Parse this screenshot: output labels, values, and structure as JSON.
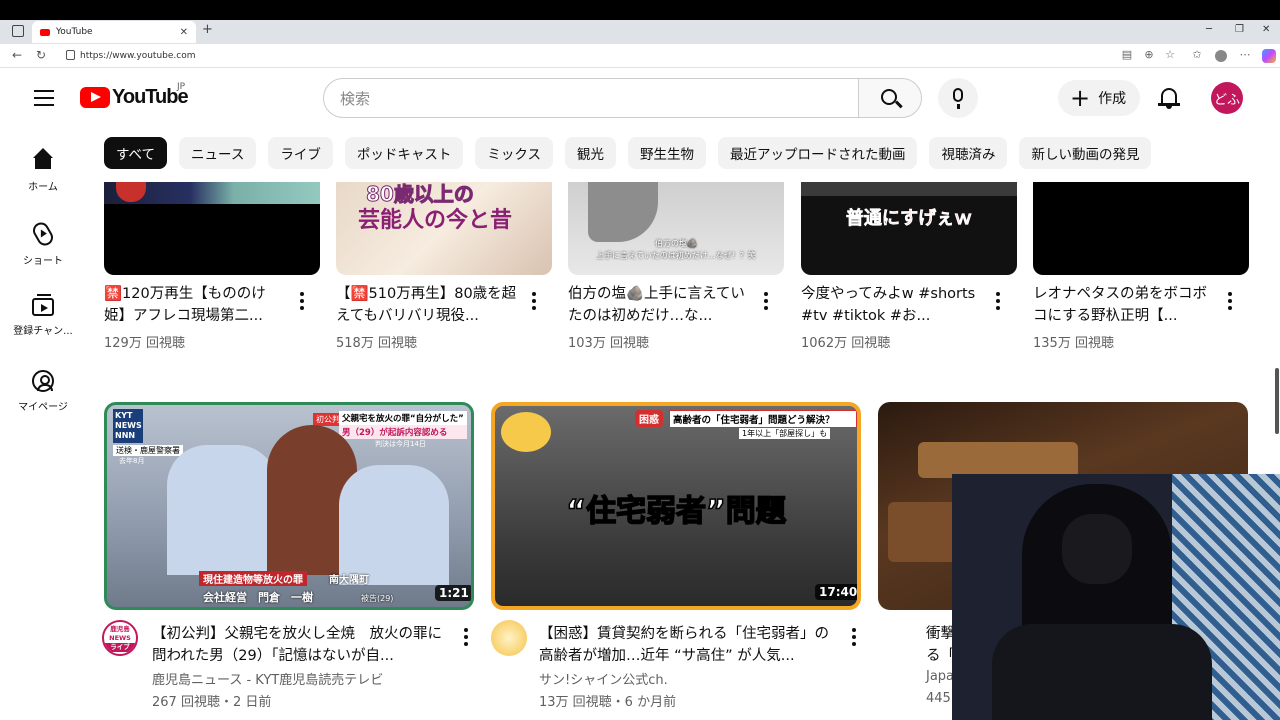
{
  "browser": {
    "tab_title": "YouTube",
    "tab_close": "✕",
    "new_tab": "+",
    "url": "https://www.youtube.com",
    "window_controls": [
      "─",
      "❐",
      "✕"
    ]
  },
  "header": {
    "logo_text": "YouTube",
    "region": "JP",
    "search_placeholder": "検索",
    "create_label": "作成",
    "avatar_text": "どふ"
  },
  "chips": [
    "すべて",
    "ニュース",
    "ライブ",
    "ポッドキャスト",
    "ミックス",
    "観光",
    "野生生物",
    "最近アップロードされた動画",
    "視聴済み",
    "新しい動画の発見"
  ],
  "sidebar": {
    "items": [
      {
        "label": "ホーム"
      },
      {
        "label": "ショート"
      },
      {
        "label": "登録チャン..."
      },
      {
        "label": "マイページ"
      }
    ]
  },
  "top_row": [
    {
      "title": "🈲120万再生【もののけ姫】アフレコ現場第二...",
      "views": "129万 回視聴"
    },
    {
      "title": "【🈲510万再生】80歳を超えてもバリバリ現役...",
      "views": "518万 回視聴",
      "thumb_text_1": "80歳以上の",
      "thumb_text_2": "芸能人の今と昔"
    },
    {
      "title": "伯方の塩🪨上手に言えていたのは初めだけ…な...",
      "views": "103万 回視聴",
      "thumb_caption": "伯方の塩🪨\n上手に言えていたのは初めだけ…なぜ！？笑"
    },
    {
      "title": "今度やってみよw #shorts #tv #tiktok #お...",
      "views": "1062万 回視聴",
      "thumb_text": "普通にすげぇｗ"
    },
    {
      "title": "レオナペタスの弟をボコボコにする野杁正明【...",
      "views": "135万 回視聴"
    }
  ],
  "bottom_row": [
    {
      "title": "【初公判】父親宅を放火し全焼　放火の罪に問われた男（29）「記憶はないが自...",
      "channel": "鹿児島ニュース - KYT鹿児島読売テレビ",
      "meta": "267 回視聴・2 日前",
      "duration": "1:21",
      "thumb_badge": "KYT NEWS NNN",
      "thumb_headline_1": "父親宅を放火の罪“自分がした”",
      "thumb_headline_2": "男（29）が起訴内容認める",
      "thumb_sub": "判決は今月14日",
      "thumb_label": "初公判",
      "thumb_lower_1": "現住建造物等放火の罪",
      "thumb_lower_place": "南大隅町",
      "thumb_lower_2": "会社経営　門倉　一樹",
      "thumb_lower_tag": "被告(29)",
      "thumb_corner": "送検・鹿屋警察署",
      "thumb_corner_date": "去年8月",
      "avatar_line1": "鹿児島",
      "avatar_line2": "NEWS",
      "avatar_line3": "ライブ"
    },
    {
      "title": "【困惑】賃貸契約を断られる「住宅弱者」の高齢者が増加…近年 “サ高住” が人気...",
      "channel": "サン!シャイン公式ch.",
      "meta": "13万 回視聴・6 か月前",
      "duration": "17:40",
      "thumb_tag": "困惑",
      "thumb_headline": "高齢者の「住宅弱者」問題どう解決？",
      "thumb_sub": "1年以上「部屋探し」も",
      "thumb_big": "“住宅弱者”問題"
    },
    {
      "title": "衝撃",
      "title_line2": "る「",
      "channel": "Japa",
      "meta": "445"
    }
  ],
  "colors": {
    "yt_red": "#ff0000",
    "avatar_bg": "#c2185b",
    "thumb1_border": "#2e8b57",
    "thumb2_border": "#f5a623"
  }
}
